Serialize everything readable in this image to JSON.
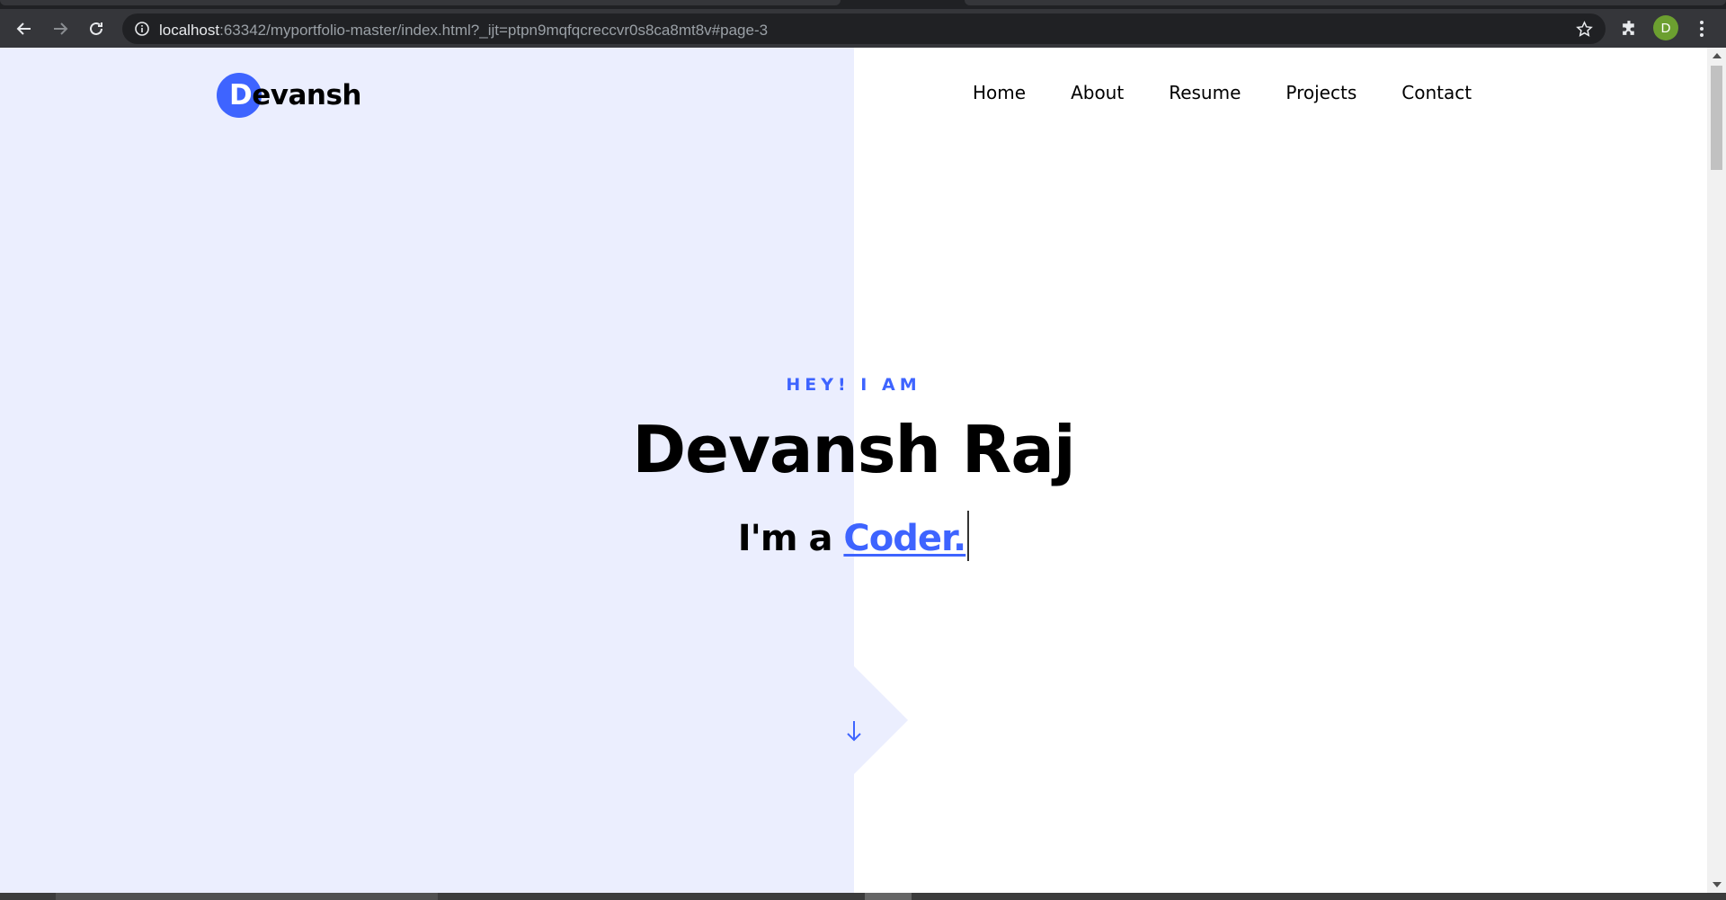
{
  "browser": {
    "url_host": "localhost",
    "url_rest": ":63342/myportfolio-master/index.html?_ijt=ptpn9mqfqcreccvr0s8ca8mt8v#page-3",
    "profile_initial": "D"
  },
  "site": {
    "logo_first": "D",
    "logo_rest": "evansh",
    "nav": [
      "Home",
      "About",
      "Resume",
      "Projects",
      "Contact"
    ]
  },
  "hero": {
    "kicker": "HEY! I AM",
    "name": "Devansh Raj",
    "role_prefix": "I'm a ",
    "role_typed": "Coder."
  },
  "colors": {
    "accent": "#3e64ff",
    "left_panel": "#ebeefe",
    "right_panel": "#ffffff"
  }
}
